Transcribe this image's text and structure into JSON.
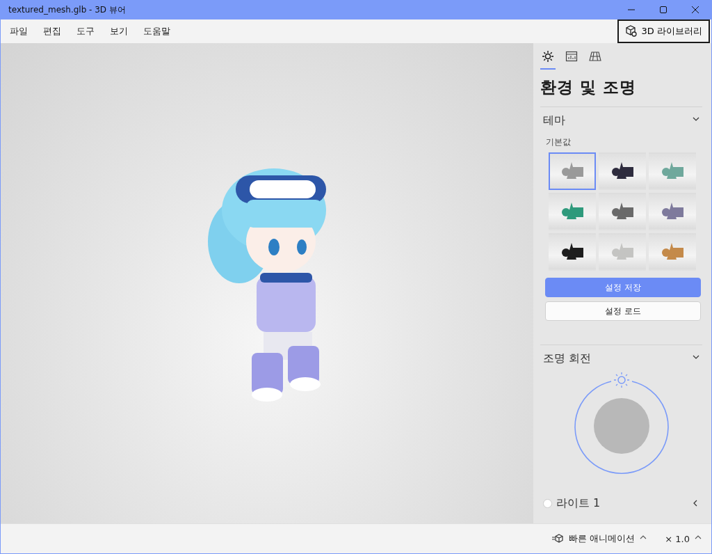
{
  "window": {
    "title": "textured_mesh.glb - 3D 뷰어"
  },
  "menu": [
    "파일",
    "편집",
    "도구",
    "보기",
    "도움말"
  ],
  "library_button": {
    "label": "3D 라이브러리"
  },
  "panel": {
    "tabs": [
      {
        "kind": "lighting",
        "selected": true
      },
      {
        "kind": "stats",
        "selected": false
      },
      {
        "kind": "grid",
        "selected": false
      }
    ],
    "title": "환경 및 조명",
    "theme": {
      "heading": "테마",
      "expanded": true,
      "label": "기본값",
      "swatches": [
        {
          "color": "#9a9a9a",
          "selected": true
        },
        {
          "color": "#2e2c3e",
          "selected": false
        },
        {
          "color": "#6fa89c",
          "selected": false
        },
        {
          "color": "#2f9a7c",
          "selected": false
        },
        {
          "color": "#6a6a6a",
          "selected": false
        },
        {
          "color": "#7e7a9c",
          "selected": false
        },
        {
          "color": "#1e1e1e",
          "selected": false
        },
        {
          "color": "#c4c4c2",
          "selected": false
        },
        {
          "color": "#c48a4a",
          "selected": false
        }
      ],
      "buttons": [
        {
          "label": "설정 저장",
          "kind": "primary"
        },
        {
          "label": "설정 로드",
          "kind": "secondary"
        }
      ]
    },
    "rotation": {
      "heading": "조명 회전",
      "expanded": true
    },
    "lights": [
      {
        "label": "라이트 1",
        "expanded": false
      }
    ]
  },
  "status_bar": {
    "animation": "빠른 애니메이션",
    "speed": "× 1.0"
  }
}
